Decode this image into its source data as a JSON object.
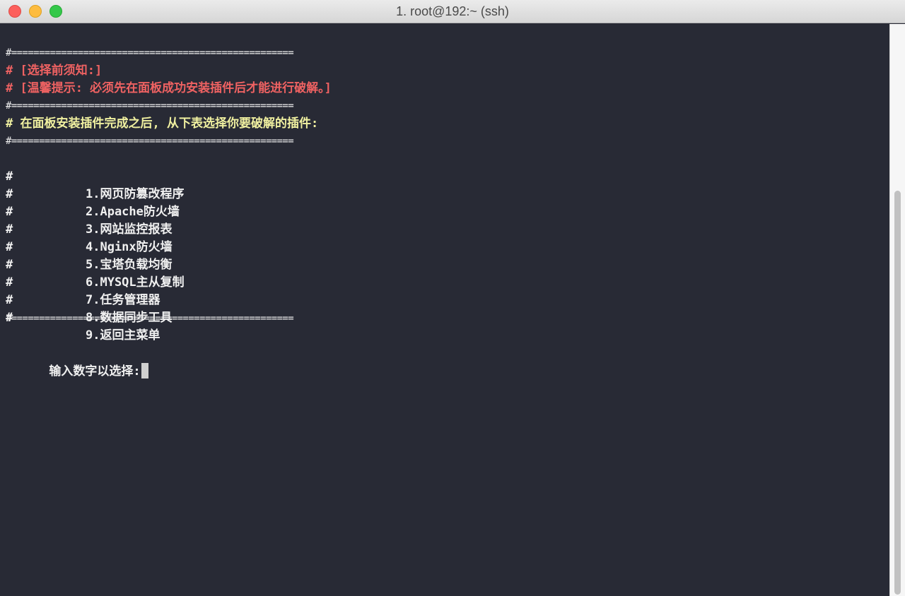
{
  "window": {
    "title": "1. root@192:~ (ssh)"
  },
  "terminal": {
    "divider": "#===================================================",
    "notice_heading": "# [选择前须知:]",
    "notice_tip": "# [温馨提示: 必须先在面板成功安装插件后才能进行破解。]",
    "instruction": "# 在面板安装插件完成之后, 从下表选择你要破解的插件:",
    "menu_hash": "#",
    "menu_items": [
      "1.网页防篡改程序",
      "2.Apache防火墙",
      "3.网站监控报表",
      "4.Nginx防火墙",
      "5.宝塔负载均衡",
      "6.MYSQL主从复制",
      "7.任务管理器",
      "8.数据同步工具",
      "9.返回主菜单"
    ],
    "prompt": "输入数字以选择:"
  },
  "colors": {
    "background": "#282a35",
    "text": "#f0f0f0",
    "red": "#ef6262",
    "yellow": "#f0f0a0"
  },
  "icons": {
    "close": "close-icon",
    "minimize": "minimize-icon",
    "zoom": "zoom-icon"
  }
}
